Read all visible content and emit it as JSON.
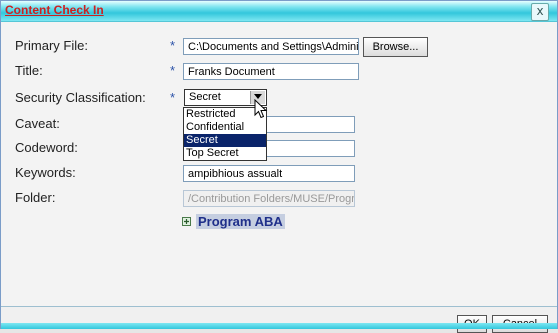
{
  "window": {
    "title": "Content Check In",
    "close_glyph": "x"
  },
  "form": {
    "primary_file": {
      "label": "Primary File:",
      "required": "*",
      "value": "C:\\Documents and Settings\\Adminis",
      "browse_label": "Browse..."
    },
    "title": {
      "label": "Title:",
      "required": "*",
      "value": "Franks Document"
    },
    "security": {
      "label": "Security Classification:",
      "required": "*",
      "selected": "Secret",
      "options": [
        "Restricted",
        "Confidential",
        "Secret",
        "Top Secret"
      ],
      "highlighted_index": 2
    },
    "caveat": {
      "label": "Caveat:",
      "value": ""
    },
    "codeword": {
      "label": "Codeword:",
      "value": ""
    },
    "keywords": {
      "label": "Keywords:",
      "value": "ampibhious assualt"
    },
    "folder": {
      "label": "Folder:",
      "value": "/Contribution Folders/MUSE/Program"
    }
  },
  "tree": {
    "expander_icon": "plus-expander-icon",
    "label": "Program ABA"
  },
  "buttons": {
    "ok": "OK",
    "cancel": "Cancel"
  },
  "colors": {
    "title_text": "#cc2020",
    "selected_option": "#0a246a",
    "required_star": "#2b52a8"
  }
}
